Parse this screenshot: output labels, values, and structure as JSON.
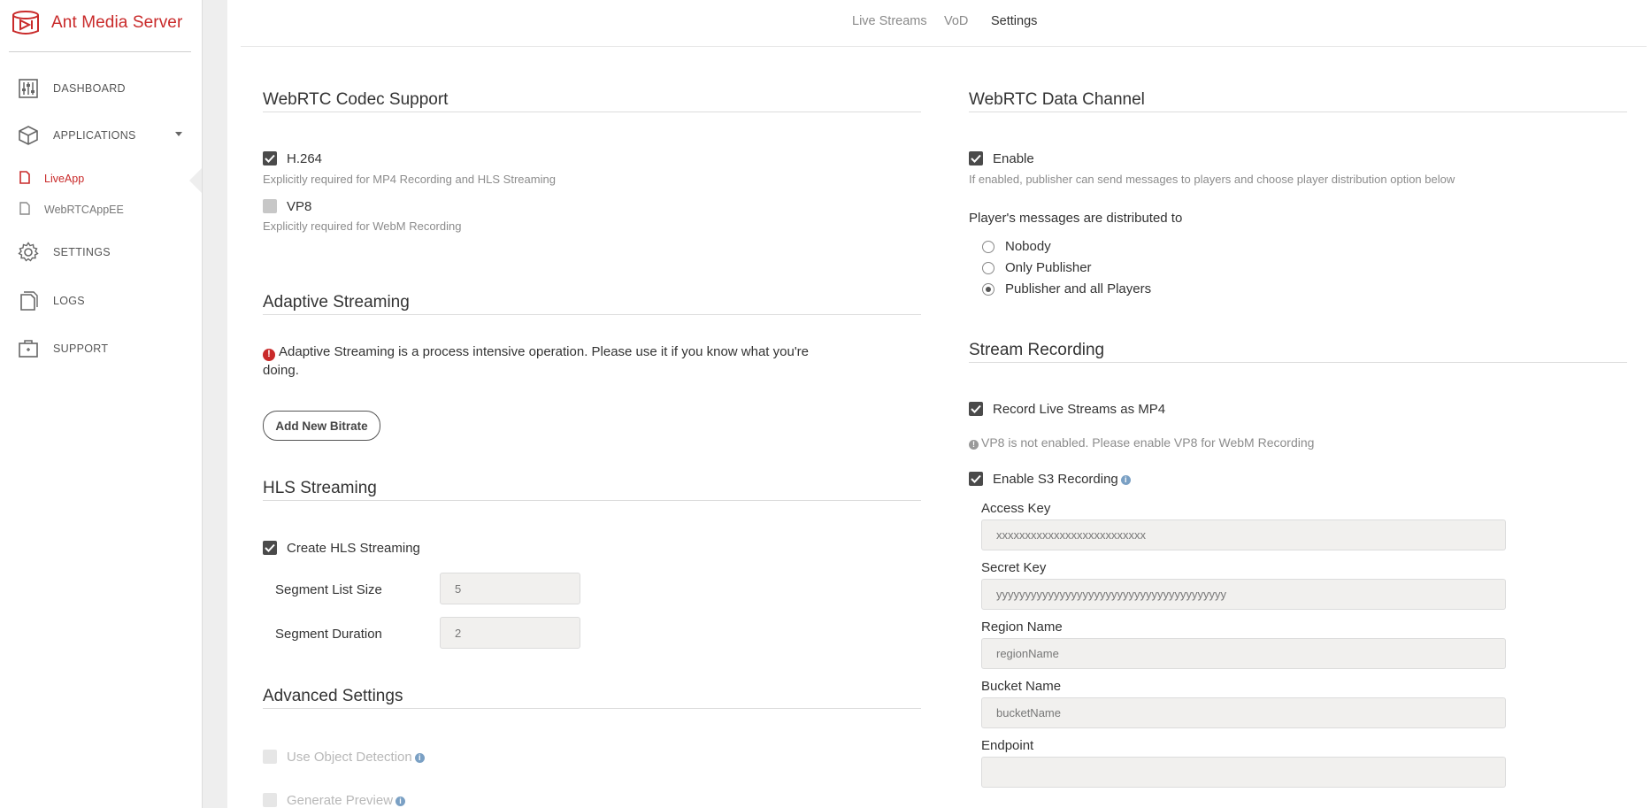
{
  "app": {
    "name": "Ant Media Server",
    "brand_color": "#c92a2a"
  },
  "sidebar": {
    "items": [
      {
        "label": "DASHBOARD",
        "icon": "sliders-icon"
      },
      {
        "label": "APPLICATIONS",
        "icon": "cube-icon"
      },
      {
        "label": "SETTINGS",
        "icon": "gear-icon"
      },
      {
        "label": "LOGS",
        "icon": "logs-icon"
      },
      {
        "label": "SUPPORT",
        "icon": "support-icon"
      }
    ],
    "apps": [
      {
        "label": "LiveApp",
        "active": true
      },
      {
        "label": "WebRTCAppEE",
        "active": false
      }
    ]
  },
  "tabs": [
    {
      "label": "Live Streams",
      "active": false
    },
    {
      "label": "VoD",
      "active": false
    },
    {
      "label": "Settings",
      "active": true
    }
  ],
  "codec": {
    "title": "WebRTC Codec Support",
    "h264": {
      "label": "H.264",
      "checked": true,
      "help": "Explicitly required for MP4 Recording and HLS Streaming"
    },
    "vp8": {
      "label": "VP8",
      "checked": false,
      "help": "Explicitly required for WebM Recording"
    }
  },
  "adaptive": {
    "title": "Adaptive Streaming",
    "warning": "Adaptive Streaming is a process intensive operation. Please use it if you know what you're",
    "warning_cont": "doing.",
    "button": "Add New Bitrate"
  },
  "hls": {
    "title": "HLS Streaming",
    "enable": {
      "label": "Create HLS Streaming",
      "checked": true
    },
    "segment_list_size": {
      "label": "Segment List Size",
      "value": "5"
    },
    "segment_duration": {
      "label": "Segment Duration",
      "value": "2"
    }
  },
  "advanced": {
    "title": "Advanced Settings",
    "object_detection": {
      "label": "Use Object Detection",
      "checked": false
    },
    "preview": {
      "label": "Generate Preview",
      "checked": false
    }
  },
  "datachannel": {
    "title": "WebRTC Data Channel",
    "enable": {
      "label": "Enable",
      "checked": true
    },
    "help": "If enabled, publisher can send messages to players and choose player distribution option below",
    "distribution_label": "Player's messages are distributed to",
    "options": [
      {
        "label": "Nobody",
        "selected": false
      },
      {
        "label": "Only Publisher",
        "selected": false
      },
      {
        "label": "Publisher and all Players",
        "selected": true
      }
    ]
  },
  "recording": {
    "title": "Stream Recording",
    "mp4": {
      "label": "Record Live Streams as MP4",
      "checked": true
    },
    "vp8_note": "VP8 is not enabled. Please enable VP8 for WebM Recording",
    "s3": {
      "label": "Enable S3 Recording",
      "checked": true
    },
    "access_key": {
      "label": "Access Key",
      "value": "xxxxxxxxxxxxxxxxxxxxxxxxxx"
    },
    "secret_key": {
      "label": "Secret Key",
      "value": "yyyyyyyyyyyyyyyyyyyyyyyyyyyyyyyyyyyyyyyy"
    },
    "region": {
      "label": "Region Name",
      "value": "regionName"
    },
    "bucket": {
      "label": "Bucket Name",
      "value": "bucketName"
    },
    "endpoint": {
      "label": "Endpoint",
      "value": ""
    }
  }
}
